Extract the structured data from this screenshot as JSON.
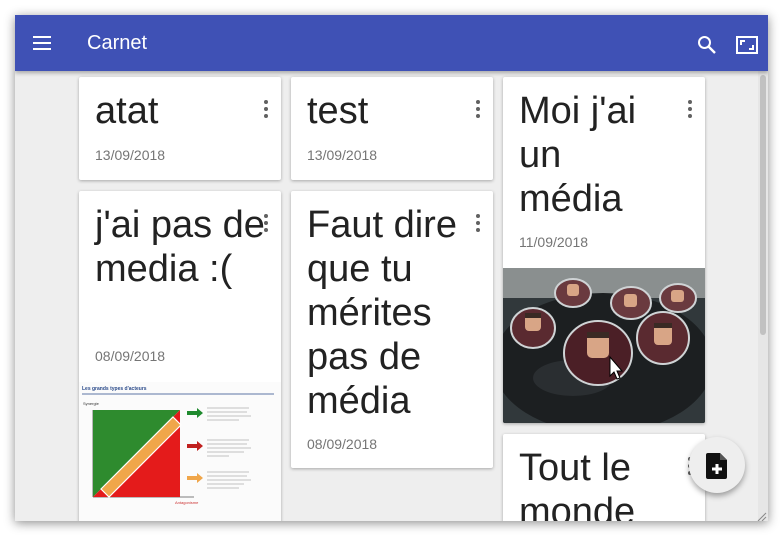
{
  "app": {
    "title": "Carnet"
  },
  "notes": [
    {
      "title": "atat",
      "date": "13/09/2018"
    },
    {
      "title": "test",
      "date": "13/09/2018"
    },
    {
      "title": "Moi j'ai un média",
      "date": "11/09/2018"
    },
    {
      "title": "j'ai pas de media :(",
      "date": "08/09/2018"
    },
    {
      "title": "Faut dire que tu mérites pas de média",
      "date": "08/09/2018"
    },
    {
      "title": "Tout le monde",
      "date": ""
    }
  ],
  "media": {
    "chart_title": "Les grands types d'acteurs",
    "chart_ylabel": "Synergie",
    "chart_xlabel": "Antagonisme"
  },
  "colors": {
    "appbar": "#3f51b5",
    "background": "#eeeeee",
    "card": "#ffffff",
    "date": "#757575"
  },
  "icons": {
    "menu": "menu-icon",
    "search": "search-icon",
    "fullscreen": "fullscreen-icon",
    "add_note": "note-add-icon",
    "more": "more-vert-icon"
  }
}
